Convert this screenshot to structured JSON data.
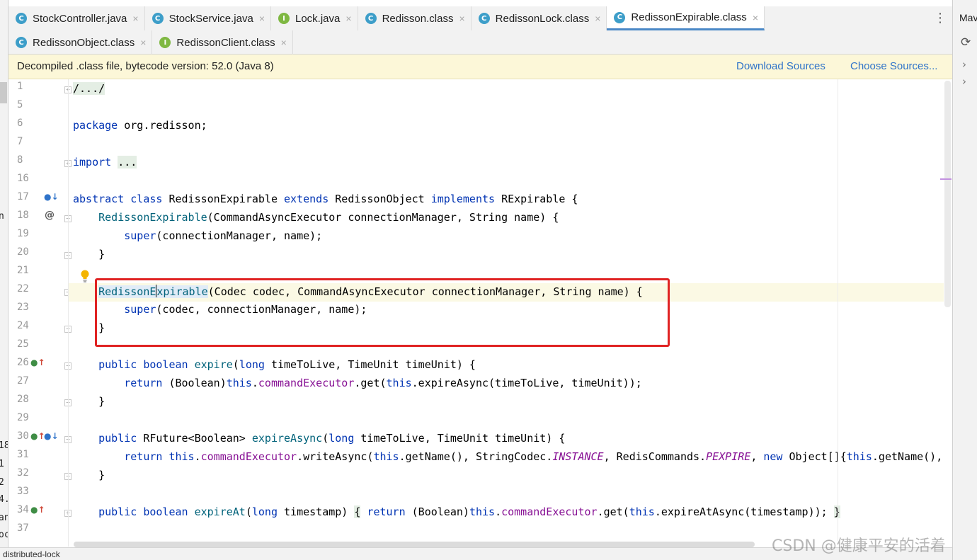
{
  "tabs_row1": [
    {
      "icon": "C",
      "label": "StockController.java"
    },
    {
      "icon": "C",
      "label": "StockService.java"
    },
    {
      "icon": "I",
      "label": "Lock.java"
    },
    {
      "icon": "C",
      "label": "Redisson.class"
    },
    {
      "icon": "C",
      "label": "RedissonLock.class"
    },
    {
      "icon": "C",
      "label": "RedissonExpirable.class",
      "active": true
    }
  ],
  "tabs_row2": [
    {
      "icon": "C",
      "label": "RedissonObject.class"
    },
    {
      "icon": "I",
      "label": "RedissonClient.class"
    }
  ],
  "tab_close_glyph": "×",
  "tab_menu_glyph": "⋮",
  "right_panel": {
    "title": "Mav"
  },
  "banner": {
    "text": "Decompiled .class file, bytecode version: 52.0 (Java 8)",
    "download_label": "Download Sources",
    "choose_label": "Choose Sources..."
  },
  "line_numbers": [
    "1",
    "5",
    "6",
    "7",
    "8",
    "16",
    "17",
    "18",
    "19",
    "20",
    "21",
    "22",
    "23",
    "24",
    "25",
    "26",
    "27",
    "28",
    "29",
    "30",
    "31",
    "32",
    "33",
    "34",
    "37"
  ],
  "code": {
    "l1": "/.../",
    "l6_kw": "package",
    "l6_rest": " org.redisson;",
    "l8_kw": "import",
    "l8_fold": "...",
    "l17_kw1": "abstract class",
    "l17_name": " RedissonExpirable ",
    "l17_kw2": "extends",
    "l17_mid": " RedissonObject ",
    "l17_kw3": "implements",
    "l17_end": " RExpirable {",
    "l18_fn": "RedissonExpirable",
    "l18_rest": "(CommandAsyncExecutor connectionManager, String name) {",
    "l19_kw": "super",
    "l19_rest": "(connectionManager, name);",
    "close_brace": "}",
    "l22_fn_a": "RedissonE",
    "l22_fn_b": "xpirable",
    "l22_rest": "(Codec codec, CommandAsyncExecutor connectionManager, String name) {",
    "l23_kw": "super",
    "l23_rest": "(codec, connectionManager, name);",
    "l26_kw1": "public boolean",
    "l26_fn": " expire",
    "l26_p1": "(",
    "l26_kw2": "long",
    "l26_rest": " timeToLive, TimeUnit timeUnit) {",
    "l27_kw1": "return",
    "l27_a": " (Boolean)",
    "l27_kw2": "this",
    "l27_dot": ".",
    "l27_fld": "commandExecutor",
    "l27_b": ".get(",
    "l27_kw3": "this",
    "l27_c": ".expireAsync(timeToLive, timeUnit));",
    "l30_kw1": "public",
    "l30_a": " RFuture<Boolean> ",
    "l30_fn": "expireAsync",
    "l30_p1": "(",
    "l30_kw2": "long",
    "l30_rest": " timeToLive, TimeUnit timeUnit) {",
    "l31_kw1": "return",
    "l31_sp": " ",
    "l31_kw2": "this",
    "l31_dot": ".",
    "l31_fld": "commandExecutor",
    "l31_a": ".writeAsync(",
    "l31_kw3": "this",
    "l31_b": ".getName(), StringCodec.",
    "l31_it1": "INSTANCE",
    "l31_c": ", RedisCommands.",
    "l31_it2": "PEXPIRE",
    "l31_d": ", ",
    "l31_kw4": "new",
    "l31_e": " Object[]{",
    "l31_kw5": "this",
    "l31_f": ".getName(), t",
    "l34_kw1": "public boolean",
    "l34_fn": " expireAt",
    "l34_p1": "(",
    "l34_kw2": "long",
    "l34_a": " timestamp) ",
    "l34_fold_open": "{",
    "l34_kw3": " return",
    "l34_b": " (Boolean)",
    "l34_kw4": "this",
    "l34_dot": ".",
    "l34_fld": "commandExecutor",
    "l34_c": ".get(",
    "l34_kw5": "this",
    "l34_d": ".expireAtAsync(timestamp)); ",
    "l34_fold_close": "}"
  },
  "gutter_marks": {
    "at_sign": "@"
  },
  "left_fragments": [
    "n",
    "18",
    "1",
    "2",
    "4.",
    "an",
    "oc"
  ],
  "status_text": "distributed-lock",
  "watermark": "CSDN @健康平安的活着",
  "colors": {
    "accent": "#4a88c7",
    "highlight_box": "#e02323",
    "keyword": "#0033b3",
    "method": "#00627a",
    "field": "#871094"
  }
}
